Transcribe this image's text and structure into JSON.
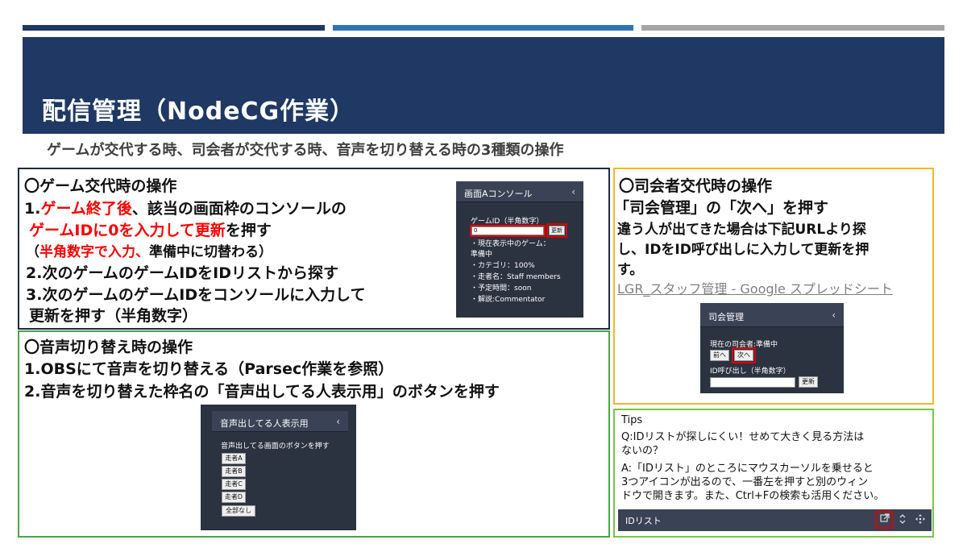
{
  "slide": {
    "title": "配信管理（NodeCG作業）",
    "subtitle": "ゲームが交代する時、司会者が交代する時、音声を切り替える時の3種類の操作"
  },
  "game_section": {
    "heading": "〇ゲーム交代時の操作",
    "line1_prefix": "1.",
    "line1_red": "ゲーム終了後",
    "line1_rest": "、該当の画面枠のコンソールの",
    "line2_red": "ゲームIDに0を入力して更新",
    "line2_rest": "を押す",
    "line3_open": "（",
    "line3_red": "半角数字で入力、",
    "line3_rest": "準備中に切替わる）",
    "line4": "2.次のゲームのゲームIDをIDリストから探す",
    "line5": "3.次のゲームのゲームIDをコンソールに入力して",
    "line6": "更新を押す（半角数字）",
    "console": {
      "title": "画面Aコンソール",
      "chevron": "‹",
      "label": "ゲームID（半角数字）",
      "input_value": "0",
      "update_button": "更新",
      "current_game_label": "・現在表示中のゲーム：",
      "current_game_value": "準備中",
      "category": "・カテゴリ：100%",
      "runner": "・走者名：Staff members",
      "estimate": "・予定時間：soon",
      "commentary": "・解説:Commentator"
    }
  },
  "audio_section": {
    "heading": "〇音声切り替え時の操作",
    "line1": "1.OBSにて音声を切り替える（Parsec作業を参照）",
    "line2": "2.音声を切り替えた枠名の「音声出してる人表示用」のボタンを押す",
    "panel": {
      "title": "音声出してる人表示用",
      "chevron": "‹",
      "instruction": "音声出してる画面のボタンを押す",
      "buttons": [
        "走者A",
        "走者B",
        "走者C",
        "走者D",
        "全部なし"
      ]
    }
  },
  "mc_section": {
    "heading": "〇司会者交代時の操作",
    "line1": "「司会管理」の「次へ」を押す",
    "line2": "違う人が出てきた場合は下記URLより探",
    "line3": "し、IDをID呼び出しに入力して更新を押",
    "line4": "す。",
    "link": "LGR_スタッフ管理 - Google スプレッドシート",
    "panel": {
      "title": "司会管理",
      "chevron": "‹",
      "current": "現在の司会者:準備中",
      "prev_button": "前へ",
      "next_button": "次へ",
      "id_label": "ID呼び出し（半角数字）",
      "update_button": "更新"
    }
  },
  "tips_section": {
    "title": "Tips",
    "q1": "Q:IDリストが探しにくい！せめて大きく見る方法は",
    "q2": "ないの？",
    "a1": "A:「IDリスト」のところにマウスカーソルを乗せると",
    "a2": "3つアイコンが出るので、一番左を押すと別のウィン",
    "a3": "ドウで開きます。また、Ctrl+Fの検索も活用ください。",
    "idlist_label": "IDリスト",
    "icons": [
      "open-external-icon",
      "resize-vertical-icon",
      "move-icon"
    ]
  },
  "colors": {
    "navy": "#1f3864",
    "blue": "#2e75b6",
    "gray": "#a5a5a5",
    "red": "#ff0000",
    "yellow_border": "#f2b824",
    "green_border": "#4ca34c",
    "panel_bg": "#2b3240"
  }
}
